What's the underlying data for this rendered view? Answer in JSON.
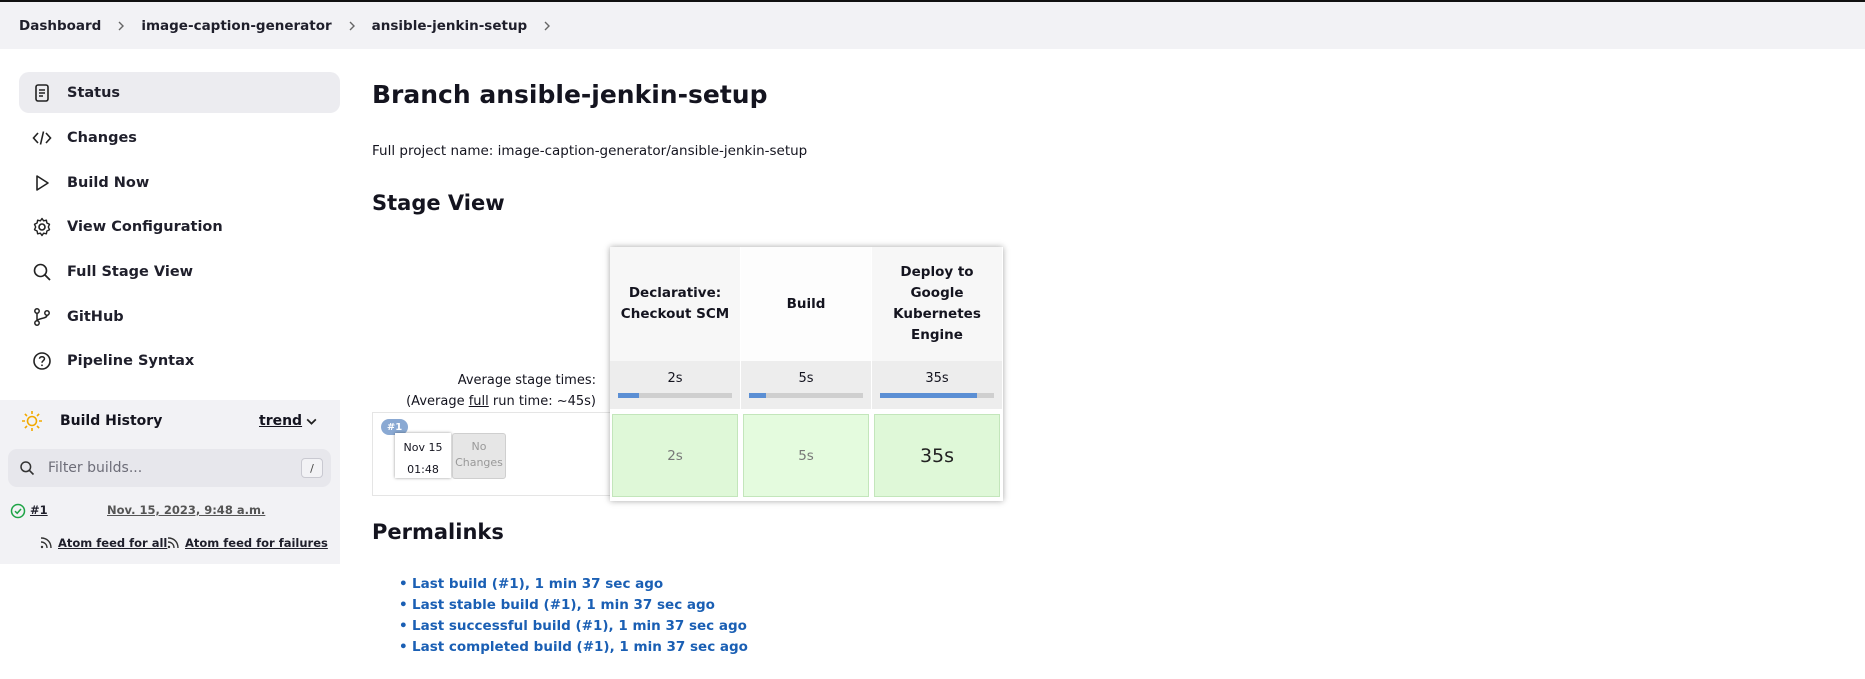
{
  "breadcrumb": [
    "Dashboard",
    "image-caption-generator",
    "ansible-jenkin-setup"
  ],
  "sidebar": {
    "items": [
      {
        "label": "Status",
        "icon": "document-icon",
        "active": true
      },
      {
        "label": "Changes",
        "icon": "code-icon"
      },
      {
        "label": "Build Now",
        "icon": "play-icon"
      },
      {
        "label": "View Configuration",
        "icon": "gear-icon"
      },
      {
        "label": "Full Stage View",
        "icon": "search-icon"
      },
      {
        "label": "GitHub",
        "icon": "git-branch-icon"
      },
      {
        "label": "Pipeline Syntax",
        "icon": "help-icon"
      }
    ]
  },
  "build_history": {
    "title": "Build History",
    "trend": "trend",
    "filter_placeholder": "Filter builds...",
    "shortcut": "/",
    "builds": [
      {
        "number": "#1",
        "date": "Nov. 15, 2023, 9:48 a.m.",
        "status": "success"
      }
    ],
    "feed_all": "Atom feed for all",
    "feed_failures": "Atom feed for failures"
  },
  "main": {
    "title": "Branch ansible-jenkin-setup",
    "project_name": "Full project name: image-caption-generator/ansible-jenkin-setup",
    "stage_view_title": "Stage View",
    "permalinks_title": "Permalinks"
  },
  "stage_view": {
    "avg_label_1": "Average stage times:",
    "avg_label_2a": "(Average ",
    "avg_label_2b": "full",
    "avg_label_2c": " run time: ~45s)",
    "stages": [
      {
        "name": "Declarative: Checkout SCM",
        "avg": "2s",
        "progress": 0.18,
        "result": "2s"
      },
      {
        "name": "Build",
        "avg": "5s",
        "progress": 0.15,
        "result": "5s"
      },
      {
        "name": "Deploy to Google Kubernetes Engine",
        "avg": "35s",
        "progress": 0.85,
        "result": "35s"
      }
    ],
    "run": {
      "badge": "#1",
      "date": "Nov 15",
      "time": "01:48",
      "changes_1": "No",
      "changes_2": "Changes"
    }
  },
  "permalinks": [
    "Last build (#1), 1 min 37 sec ago",
    "Last stable build (#1), 1 min 37 sec ago",
    "Last successful build (#1), 1 min 37 sec ago",
    "Last completed build (#1), 1 min 37 sec ago"
  ],
  "colors": {
    "link": "#1a5fb4",
    "success": "#1ea446",
    "stage_success": "#dff8d8",
    "progress": "#5b8fd4"
  }
}
